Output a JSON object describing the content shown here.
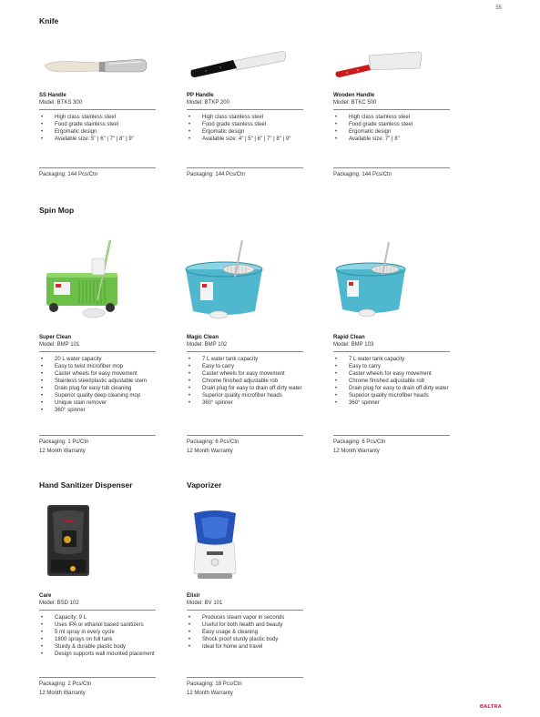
{
  "page_number": "55",
  "brand": "BALTRA",
  "sections": {
    "knife": "Knife",
    "spin_mop": "Spin Mop",
    "sanitizer": "Hand Sanitizer Dispenser",
    "vaporizer": "Vaporizer"
  },
  "products": {
    "ss_handle": {
      "name": "SS Handle",
      "model": "Model: BTKS 300",
      "features": [
        "High class stainless steel",
        "Food grade stainless steel",
        "Ergomatic design",
        "Available size: 5\" | 6\" | 7\" | 8\" | 9\""
      ],
      "packaging": "Packaging: 144 Pcs/Ctn"
    },
    "pp_handle": {
      "name": "PP Handle",
      "model": "Model: BTKP 200",
      "features": [
        "High class stainless steel",
        "Food grade stainless steel",
        "Ergomatic design",
        "Available size: 4\" | 5\" | 6\" | 7\" | 8\" | 9\""
      ],
      "packaging": "Packaging: 144 Pcs/Ctn"
    },
    "wooden_handle": {
      "name": "Wooden Handle",
      "model": "Model: BTKC 500",
      "features": [
        "High class stainless steel",
        "Food grade stainless steel",
        "Ergomatic design",
        "Available size: 7\" | 8\""
      ],
      "packaging": "Packaging: 144 Pcs/Ctn"
    },
    "super_clean": {
      "name": "Super Clean",
      "model": "Model: BMP 101",
      "features": [
        "20 L water capacity",
        "Easy to twist microfiber mop",
        "Caster wheels for easy movement",
        "Stainless steel/plastic adjustable stem",
        "Drain plug for easy tub cleaning",
        "Superior quality deep cleaning mop",
        "Unique stain remover",
        "360° spinner"
      ],
      "packaging": "Packaging: 1 Pc/Ctn",
      "warranty": "12 Month Warranty"
    },
    "magic_clean": {
      "name": "Magic Clean",
      "model": "Model: BMP 102",
      "features": [
        "7 L water tank capacity",
        "Easy to carry",
        "Caster wheels for easy movement",
        "Chrome finished adjustable rob",
        "Drain plug for easy to drain off dirty water",
        "Superior quality microfiber heads",
        "360° spinner"
      ],
      "packaging": "Packaging: 6 Pcs/Ctn",
      "warranty": "12 Month Warranty"
    },
    "rapid_clean": {
      "name": "Rapid Clean",
      "model": "Model: BMP 103",
      "features": [
        "7 L water tank capacity",
        "Easy to carry",
        "Caster wheels for easy movement",
        "Chrome finished adjustable rob",
        "Drain plug for easy to drain off dirty water",
        "Superior quality microfiber heads",
        "360° spinner"
      ],
      "packaging": "Packaging: 6 Pcs/Ctn",
      "warranty": "12 Month Warranty"
    },
    "care": {
      "name": "Care",
      "model": "Model: BSD 102",
      "features": [
        "Capacity: 9 L",
        "Uses IPA or ethanol based sanitizers",
        "5 ml spray in every cycle",
        "1800 sprays on full tank",
        "Sturdy & durable plastic body",
        "Design supports wall mounted placement"
      ],
      "packaging": "Packaging: 2 Pcs/Ctn",
      "warranty": "12 Month Warranty"
    },
    "elixir": {
      "name": "Elixir",
      "model": "Model: BV 101",
      "features": [
        "Produces steam vapor in seconds",
        "Useful for both health and beauty",
        "Easy usage & cleaning",
        "Shock proof sturdy plastic body",
        "Ideal for home and travel"
      ],
      "packaging": "Packaging: 18 Pcs/Ctn",
      "warranty": "12 Month Warranty"
    }
  },
  "colors": {
    "brand_red": "#c8102e",
    "mop_green": "#6cc04a",
    "mop_teal": "#4fb8cf"
  }
}
